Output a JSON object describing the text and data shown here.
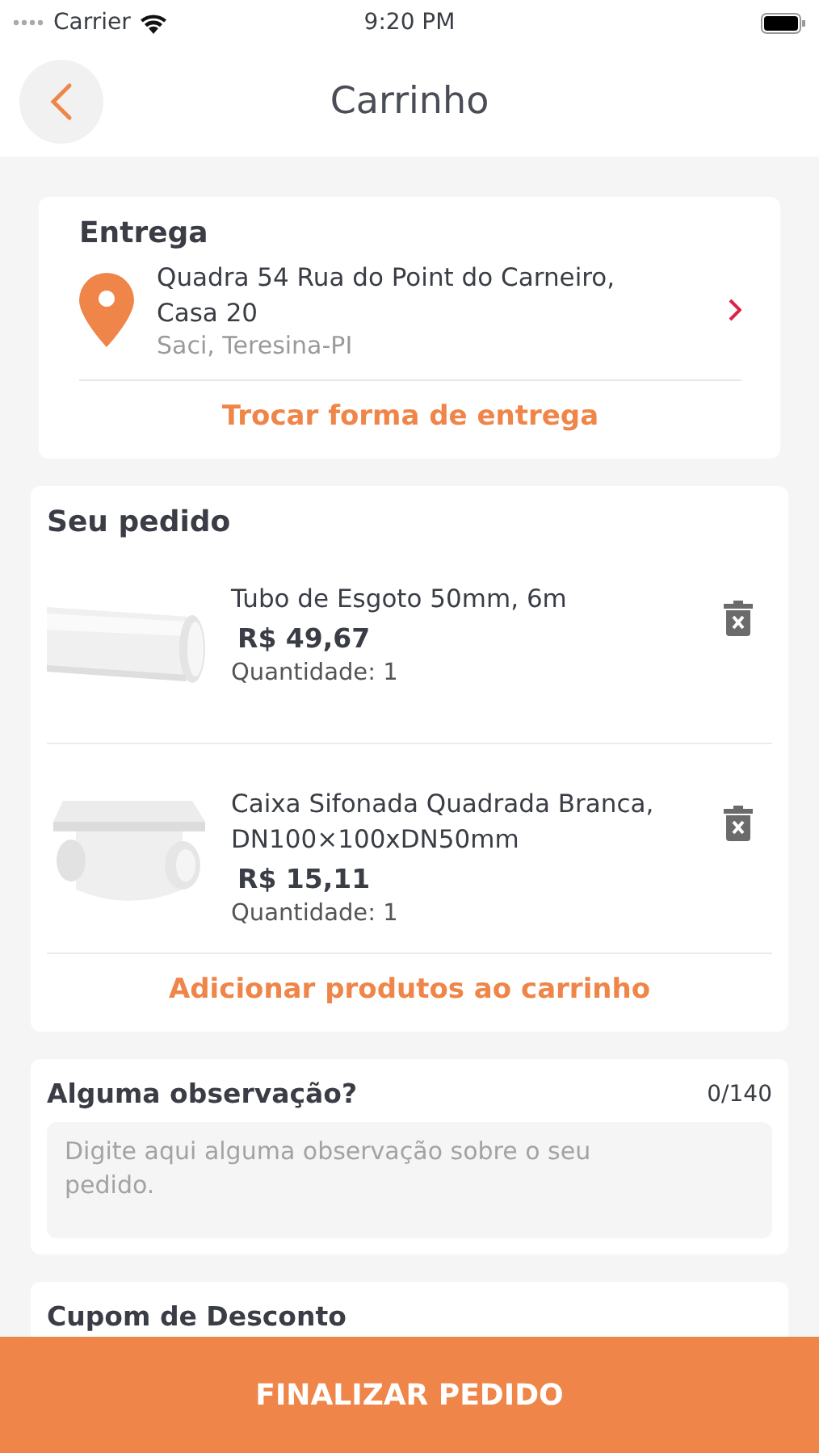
{
  "status_bar": {
    "carrier": "Carrier",
    "time": "9:20 PM"
  },
  "header": {
    "title": "Carrinho"
  },
  "delivery": {
    "title": "Entrega",
    "address": "Quadra 54 Rua do Point do Carneiro, Casa 20",
    "city": "Saci, Teresina-PI",
    "change_link": "Trocar forma de entrega"
  },
  "order": {
    "title": "Seu pedido",
    "items": [
      {
        "kind": "pipe",
        "name": "Tubo de Esgoto 50mm, 6m",
        "price": "R$ 49,67",
        "quantity": "Quantidade: 1"
      },
      {
        "kind": "box",
        "name": "Caixa Sifonada Quadrada Branca, DN100×100xDN50mm",
        "price": "R$ 15,11",
        "quantity": "Quantidade: 1"
      }
    ],
    "add_link": "Adicionar produtos ao carrinho"
  },
  "notes": {
    "title": "Alguma observação?",
    "counter": "0/140",
    "placeholder": "Digite aqui alguma observação sobre o seu pedido."
  },
  "coupon": {
    "title": "Cupom de Desconto"
  },
  "checkout_button": "FINALIZAR PEDIDO"
}
